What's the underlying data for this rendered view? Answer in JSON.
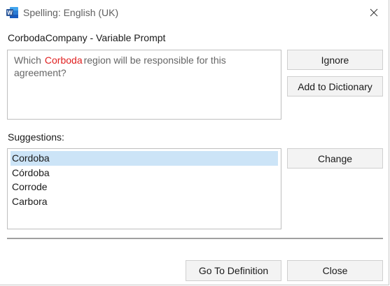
{
  "window": {
    "title": "Spelling: English (UK)",
    "app_icon": "word-icon",
    "close_icon": "close-icon"
  },
  "context": {
    "label": "CorbodaCompany - Variable Prompt",
    "text_before": "Which",
    "misspelled_word": "Corboda",
    "text_after": "region will be responsible for this agreement?"
  },
  "actions": {
    "ignore": "Ignore",
    "add_to_dictionary": "Add to Dictionary",
    "change": "Change",
    "go_to_definition": "Go To Definition",
    "close": "Close"
  },
  "suggestions": {
    "label": "Suggestions:",
    "selected_index": 0,
    "items": [
      "Cordoba",
      "Córdoba",
      "Corrode",
      "Carbora"
    ]
  },
  "colors": {
    "misspelled": "#e02020",
    "selection": "#cce4f7",
    "word_brand": "#2b579a"
  }
}
